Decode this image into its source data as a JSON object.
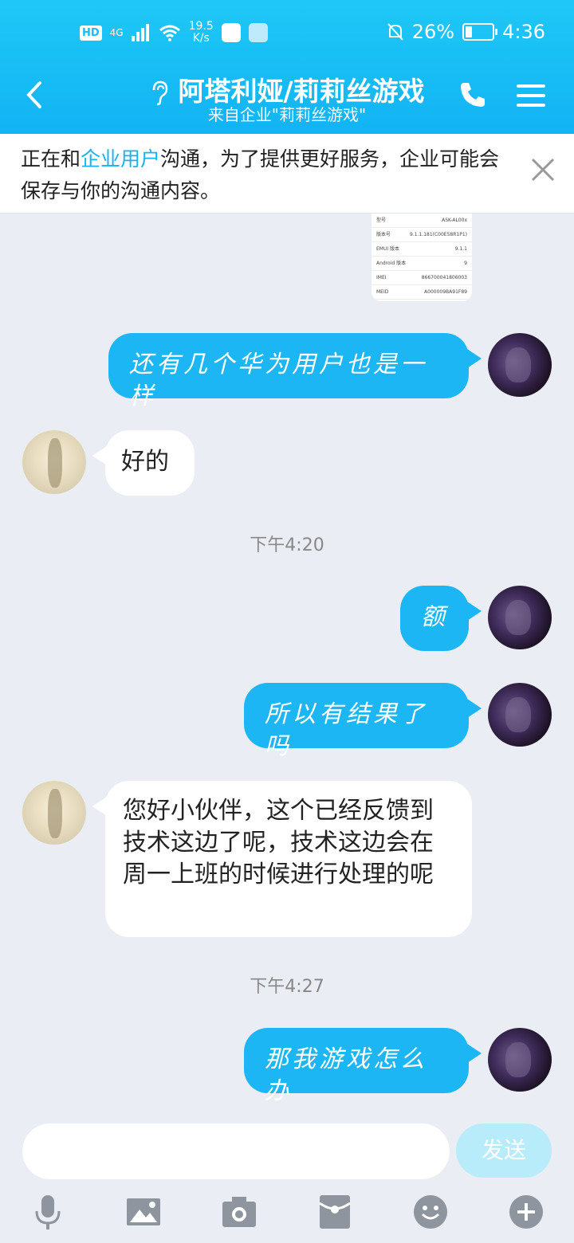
{
  "status_bar": {
    "hd": "HD",
    "network": "4G",
    "speed_value": "19.5",
    "speed_unit": "K/s",
    "battery": "26%",
    "battery_level": 0.26,
    "time": "4:36"
  },
  "header": {
    "title": "阿塔利娅/莉莉丝游戏",
    "subtitle": "来自企业\"莉莉丝游戏\""
  },
  "notice": {
    "prefix": "正在和",
    "highlight": "企业用户",
    "suffix": "沟通，为了提供更好服务，企业可能会保存与你的沟通内容。"
  },
  "screenshot_preview": {
    "rows": [
      {
        "k": "型号",
        "v": "ASK-AL00x"
      },
      {
        "k": "版本号",
        "v": "9.1.1.181(C00E58R1P1)"
      },
      {
        "k": "EMUI 版本",
        "v": "9.1.1"
      },
      {
        "k": "Android 版本",
        "v": "9"
      },
      {
        "k": "IMEI",
        "v": "866700041806003"
      },
      {
        "k": "MEID",
        "v": "A000009BA91F89"
      }
    ]
  },
  "messages": [
    {
      "from": "me",
      "text": "还有几个华为用户也是一样"
    },
    {
      "from": "other",
      "text": "好的"
    },
    {
      "time": "下午4:20"
    },
    {
      "from": "me",
      "text": "额"
    },
    {
      "from": "me",
      "text": "所以有结果了吗"
    },
    {
      "from": "other",
      "text": "您好小伙伴，这个已经反馈到技术这边了呢，技术这边会在周一上班的时候进行处理的呢"
    },
    {
      "time": "下午4:27"
    },
    {
      "from": "me",
      "text": "那我游戏怎么办"
    }
  ],
  "composer": {
    "placeholder": "",
    "send_label": "发送"
  },
  "toolbar": {
    "icons": [
      "microphone-icon",
      "image-icon",
      "camera-icon",
      "red-packet-icon",
      "emoji-icon",
      "plus-icon"
    ]
  },
  "colors": {
    "accent": "#12b3f4",
    "bubble_me": "#1db6f5",
    "background": "#eaedf3"
  }
}
